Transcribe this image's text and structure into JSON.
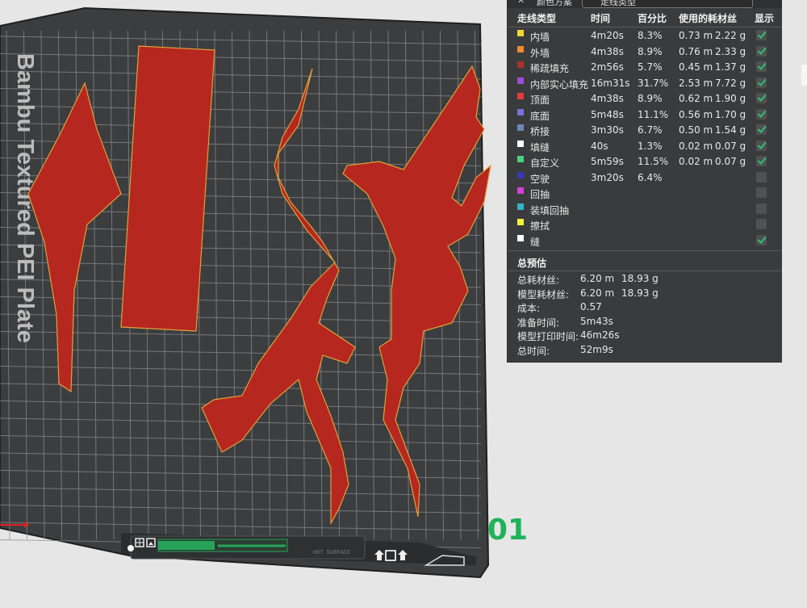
{
  "panel": {
    "header_title": "颜色方案",
    "scheme_value": "走线类型",
    "columns": [
      "走线类型",
      "时间",
      "百分比",
      "使用的耗材丝",
      "显示"
    ],
    "rows": [
      {
        "name": "内墙",
        "color": "#f3d33c",
        "time": "4m20s",
        "percent": "8.3%",
        "len": "0.73 m",
        "weight": "2.22 g",
        "shown": true
      },
      {
        "name": "外墙",
        "color": "#f08a2e",
        "time": "4m38s",
        "percent": "8.9%",
        "len": "0.76 m",
        "weight": "2.33 g",
        "shown": true
      },
      {
        "name": "稀疏填充",
        "color": "#a8322d",
        "time": "2m56s",
        "percent": "5.7%",
        "len": "0.45 m",
        "weight": "1.37 g",
        "shown": true
      },
      {
        "name": "内部实心填充",
        "color": "#9a4fd6",
        "time": "16m31s",
        "percent": "31.7%",
        "len": "2.53 m",
        "weight": "7.72 g",
        "shown": true
      },
      {
        "name": "顶面",
        "color": "#e23c3c",
        "time": "4m38s",
        "percent": "8.9%",
        "len": "0.62 m",
        "weight": "1.90 g",
        "shown": true
      },
      {
        "name": "底面",
        "color": "#7a72d8",
        "time": "5m48s",
        "percent": "11.1%",
        "len": "0.56 m",
        "weight": "1.70 g",
        "shown": true
      },
      {
        "name": "桥接",
        "color": "#6f86b8",
        "time": "3m30s",
        "percent": "6.7%",
        "len": "0.50 m",
        "weight": "1.54 g",
        "shown": true
      },
      {
        "name": "填缝",
        "color": "#ffffff",
        "time": "40s",
        "percent": "1.3%",
        "len": "0.02 m",
        "weight": "0.07 g",
        "shown": true
      },
      {
        "name": "自定义",
        "color": "#4fcf84",
        "time": "5m59s",
        "percent": "11.5%",
        "len": "0.02 m",
        "weight": "0.07 g",
        "shown": true
      },
      {
        "name": "空驶",
        "color": "#3a38b8",
        "time": "3m20s",
        "percent": "6.4%",
        "len": "",
        "weight": "",
        "shown": false
      },
      {
        "name": "回抽",
        "color": "#d53fd6",
        "time": "",
        "percent": "",
        "len": "",
        "weight": "",
        "shown": false
      },
      {
        "name": "装填回抽",
        "color": "#33b3c7",
        "time": "",
        "percent": "",
        "len": "",
        "weight": "",
        "shown": false
      },
      {
        "name": "擦拭",
        "color": "#f2f23a",
        "time": "",
        "percent": "",
        "len": "",
        "weight": "",
        "shown": false
      },
      {
        "name": "缝",
        "color": "#ffffff",
        "time": "",
        "percent": "",
        "len": "",
        "weight": "",
        "shown": true
      }
    ]
  },
  "summary": {
    "title": "总预估",
    "items": [
      {
        "label": "总耗材丝:",
        "v1": "6.20 m",
        "v2": "18.93 g"
      },
      {
        "label": "模型耗材丝:",
        "v1": "6.20 m",
        "v2": "18.93 g"
      },
      {
        "label": "成本:",
        "v1": "0.57",
        "v2": ""
      },
      {
        "label": "准备时间:",
        "v1": "5m43s",
        "v2": ""
      },
      {
        "label": "模型打印时间:",
        "v1": "46m26s",
        "v2": ""
      },
      {
        "label": "总时间:",
        "v1": "52m9s",
        "v2": ""
      }
    ]
  },
  "plate": {
    "label": "Bambu Textured PEI Plate",
    "number": "01",
    "surface_text": "HOT SURFACE",
    "bed_color": "#3c3d3e",
    "grid_color": "#8a8b8c",
    "model_color": "#b5271f",
    "model_edge_color": "#e0a23a"
  },
  "icons": [
    "close-icon",
    "chevron-down-icon",
    "grid-view-icon",
    "layout-icon",
    "upload-icon",
    "square-icon",
    "export-icon"
  ]
}
